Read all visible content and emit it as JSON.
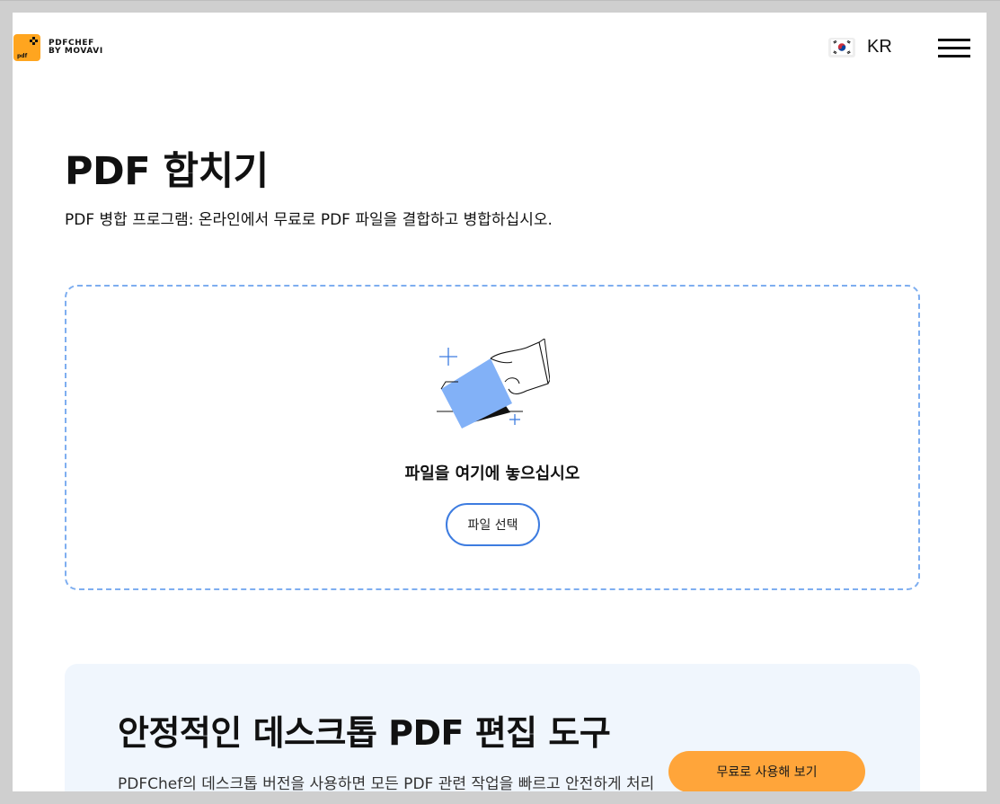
{
  "header": {
    "logo_line1": "PDFCHEF",
    "logo_line2": "BY MOVAVI",
    "logo_badge": "pdf",
    "language_code": "KR",
    "flag_icon": "south-korea-flag-icon",
    "menu_icon": "hamburger-menu-icon"
  },
  "hero": {
    "title": "PDF 합치기",
    "subtitle": "PDF 병합 프로그램: 온라인에서 무료로 PDF 파일을 결합하고 병합하십시오."
  },
  "dropzone": {
    "prompt": "파일을 여기에 놓으십시오",
    "choose_button": "파일 선택",
    "illustration_icon": "hand-dropping-file-icon"
  },
  "promo": {
    "title": "안정적인 데스크톱 PDF 편집 도구",
    "text": "PDFChef의 데스크톱 버전을 사용하면 모든 PDF 관련 작업을 빠르고 안전하게 처리할 수 있습니다. 앱을 다운로드해서 기기의 보안 위험 없이",
    "button": "무료로 사용해 보기"
  },
  "colors": {
    "brand_orange": "#ffa51f",
    "accent_blue": "#3d7ce0",
    "dropzone_border": "#7eaef0",
    "promo_background": "#f0f6fd",
    "promo_button": "#ffa53a"
  }
}
